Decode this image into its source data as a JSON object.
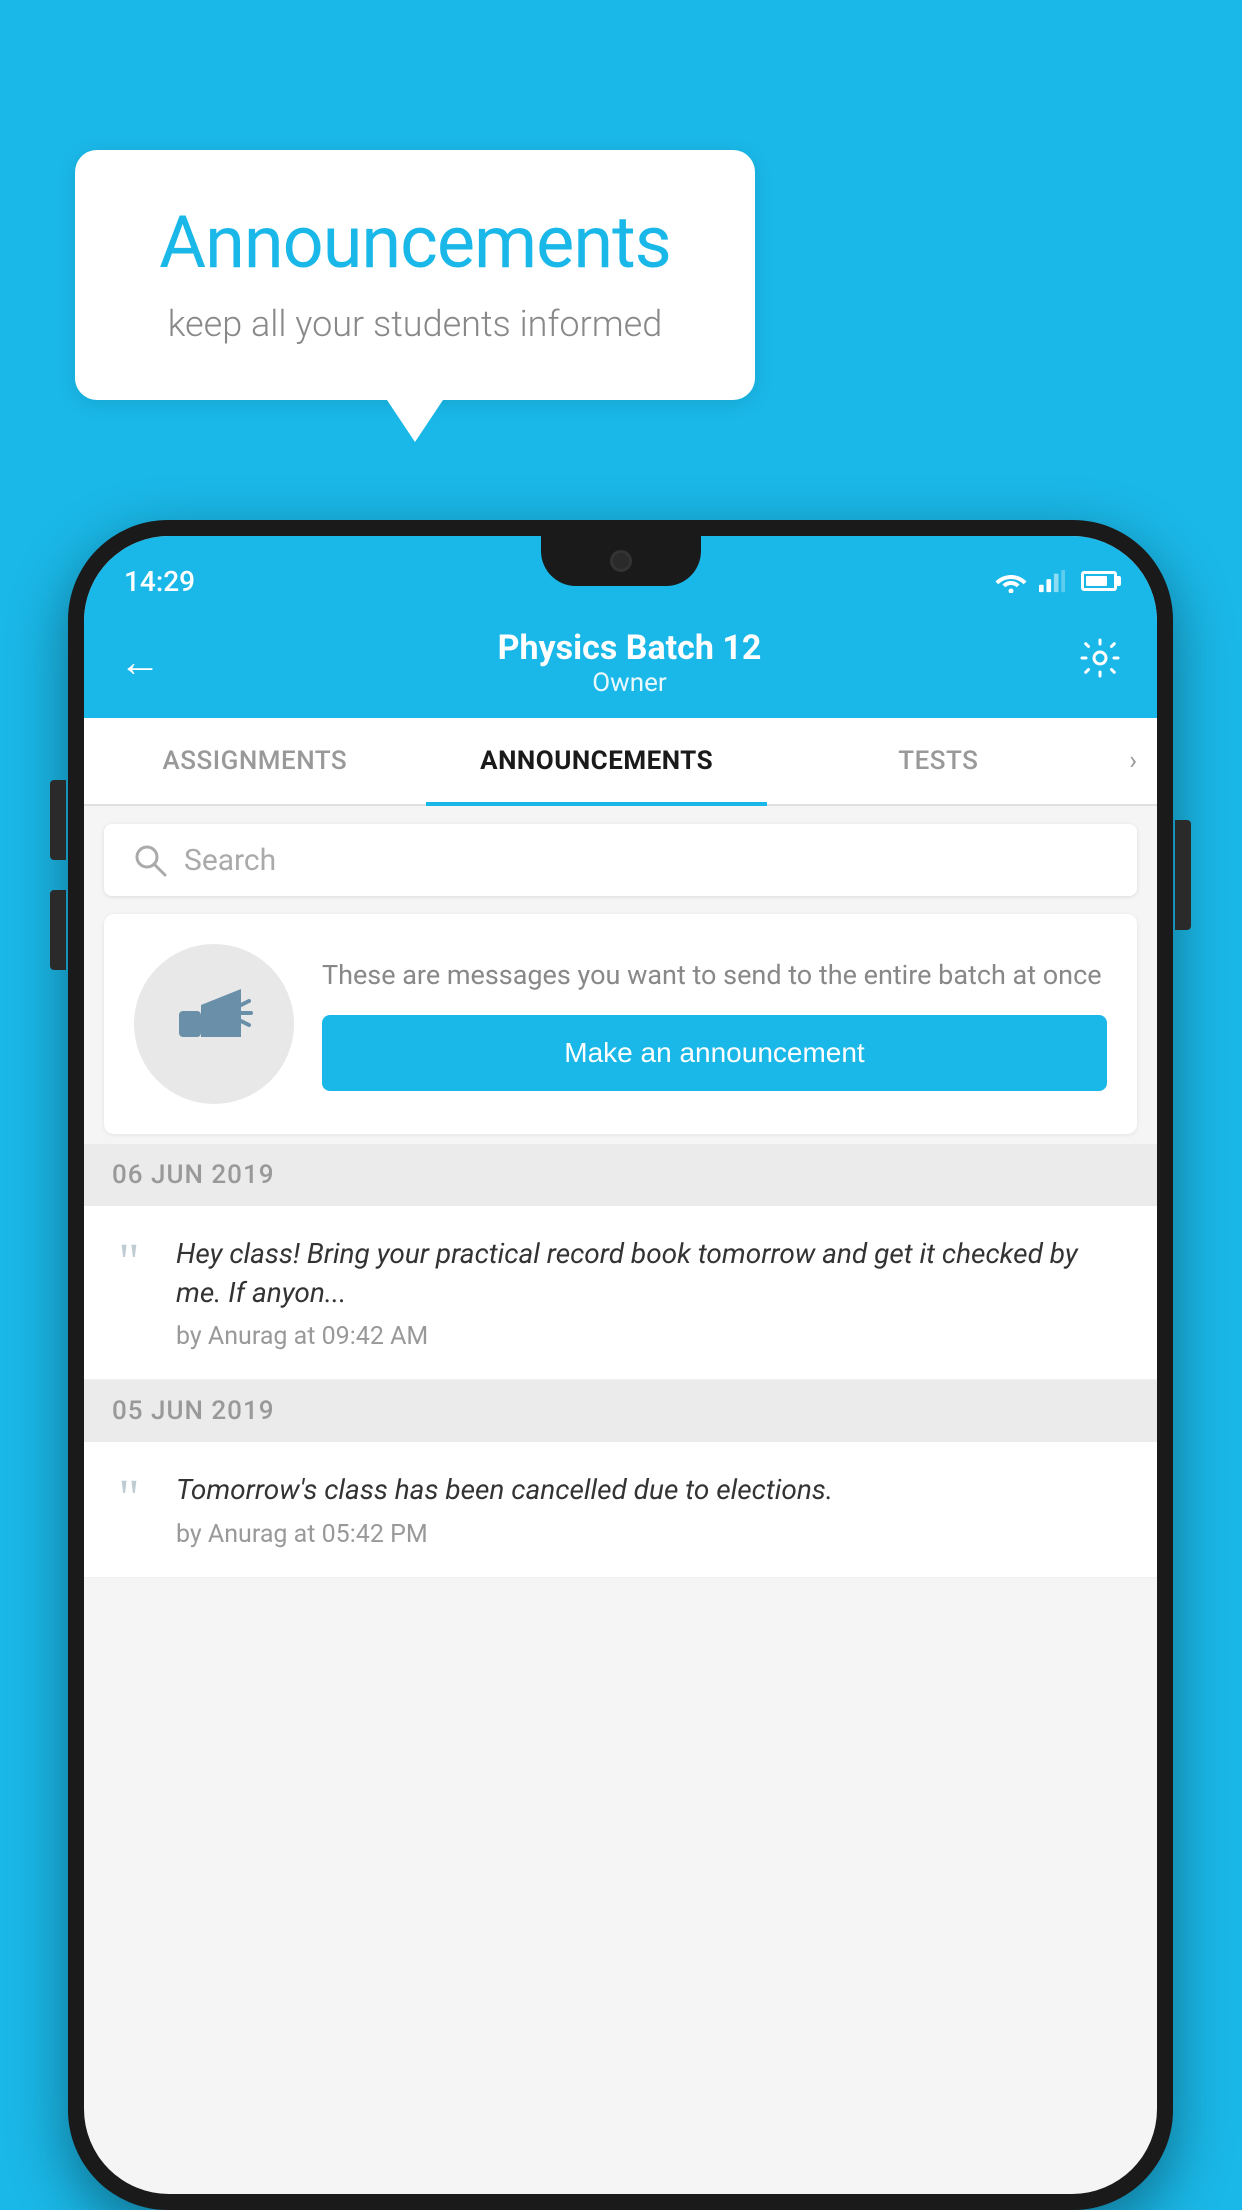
{
  "background_color": "#1ab8e8",
  "speech_bubble": {
    "title": "Announcements",
    "subtitle": "keep all your students informed"
  },
  "status_bar": {
    "time": "14:29"
  },
  "app_bar": {
    "title": "Physics Batch 12",
    "subtitle": "Owner",
    "back_label": "←",
    "settings_label": "⚙"
  },
  "tabs": [
    {
      "label": "ASSIGNMENTS",
      "active": false
    },
    {
      "label": "ANNOUNCEMENTS",
      "active": true
    },
    {
      "label": "TESTS",
      "active": false
    }
  ],
  "search": {
    "placeholder": "Search"
  },
  "promo": {
    "description": "These are messages you want to send to the entire batch at once",
    "button_label": "Make an announcement"
  },
  "date_groups": [
    {
      "date": "06  JUN  2019",
      "announcements": [
        {
          "text": "Hey class! Bring your practical record book tomorrow and get it checked by me. If anyon...",
          "meta": "by Anurag at 09:42 AM"
        }
      ]
    },
    {
      "date": "05  JUN  2019",
      "announcements": [
        {
          "text": "Tomorrow's class has been cancelled due to elections.",
          "meta": "by Anurag at 05:42 PM"
        }
      ]
    }
  ],
  "icons": {
    "megaphone": "📣"
  }
}
